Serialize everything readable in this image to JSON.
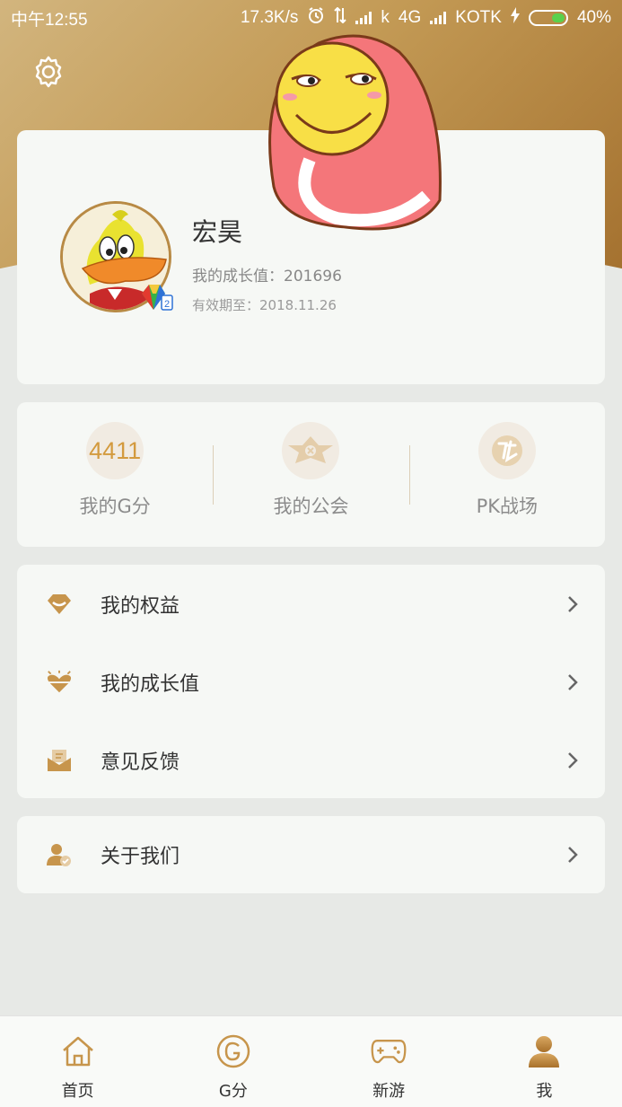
{
  "status_bar": {
    "time": "中午12:55",
    "network_speed": "17.3K/s",
    "k_label": "k",
    "network_type": "4G",
    "carrier": "KOTK",
    "battery_percent": "40%",
    "battery_level": 0.4
  },
  "profile": {
    "name": "宏昊",
    "growth_label": "我的成长值：",
    "growth_value": "201696",
    "expiry_label": "有效期至：",
    "expiry_date": "2018.11.26",
    "vip_level": "2"
  },
  "stats": [
    {
      "label": "我的G分",
      "value": "4411",
      "icon": "g-score"
    },
    {
      "label": "我的公会",
      "icon": "guild-emblem-icon"
    },
    {
      "label": "PK战场",
      "icon": "pk-battle-icon"
    }
  ],
  "menu": [
    {
      "label": "我的权益",
      "icon": "diamond-icon"
    },
    {
      "label": "我的成长值",
      "icon": "heart-growth-icon"
    },
    {
      "label": "意见反馈",
      "icon": "feedback-envelope-icon"
    }
  ],
  "about": {
    "label": "关于我们",
    "icon": "user-check-icon"
  },
  "tabs": [
    {
      "label": "首页",
      "icon": "home-icon"
    },
    {
      "label": "G分",
      "icon": "g-icon"
    },
    {
      "label": "新游",
      "icon": "gamepad-icon"
    },
    {
      "label": "我",
      "icon": "profile-icon",
      "active": true
    }
  ],
  "colors": {
    "accent": "#c39a55",
    "gold_dark": "#a4712f",
    "card_bg": "#f6f8f5",
    "page_bg": "#e7e9e6"
  }
}
